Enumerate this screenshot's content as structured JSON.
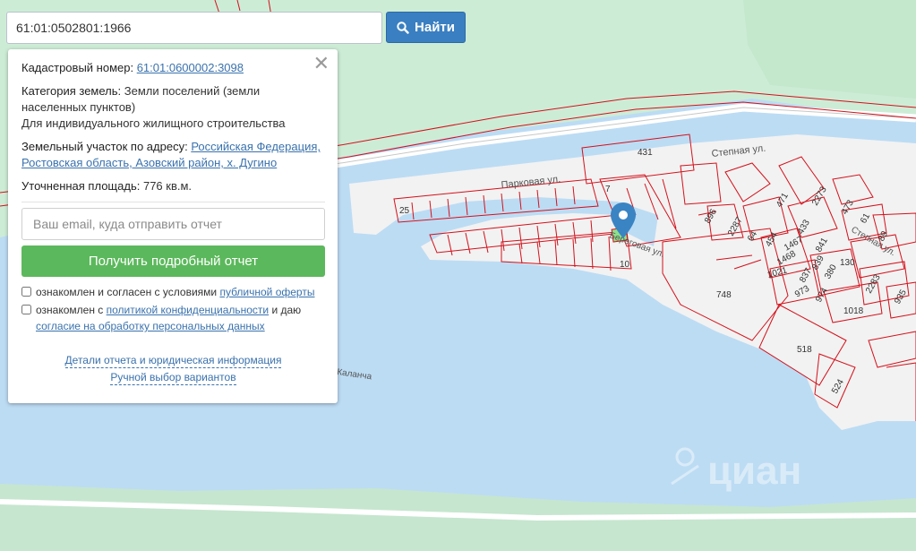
{
  "search": {
    "value": "61:01:0502801:1966",
    "button_label": "Найти",
    "button_icon": "search-icon"
  },
  "info": {
    "close_icon": "close-icon",
    "cadastral_label": "Кадастровый номер:",
    "cadastral_value": "61:01:0600002:3098",
    "category_label": "Категория земель:",
    "category_value": "Земли поселений (земли населенных пунктов)",
    "usage": "Для индивидуального жилищного строительства",
    "address_label": "Земельный участок по адресу:",
    "address_value": "Российская Федерация, Ростовская область, Азовский район, х. Дугино",
    "area_label": "Уточненная площадь:",
    "area_value": "776 кв.м.",
    "email_placeholder": "Ваш email, куда отправить отчет",
    "report_button": "Получить подробный отчет",
    "consent1_pre": "ознакомлен и согласен с условиями",
    "consent1_link": "публичной оферты",
    "consent2_pre": "ознакомлен с",
    "consent2_link": "политикой конфиденциальности",
    "consent2_mid": "и даю",
    "consent2_link2": "согласие на обработку персональных данных",
    "footer_link1": "Детали отчета и юридическая информация",
    "footer_link2": "Ручной выбор вариантов"
  },
  "map": {
    "colors": {
      "water": "#bcdcf4",
      "land": "#f2f2f2",
      "green": "#c8ead2",
      "parcel": "#d4101a",
      "selected": "#8ee08a",
      "marker": "#3a84c4"
    },
    "street_labels": [
      "Парковая ул.",
      "Степная ул.",
      "Береговая ул.",
      "Степная ул."
    ],
    "place_label": "Каланча",
    "parcel_numbers": [
      "431",
      "25",
      "7",
      "10",
      "896",
      "2287",
      "64",
      "454",
      "471",
      "2273",
      "473",
      "61",
      "89",
      "433",
      "1467",
      "841",
      "1468",
      "837",
      "839",
      "130",
      "380",
      "1021",
      "973",
      "974",
      "2283",
      "935",
      "1018",
      "748",
      "518",
      "524"
    ],
    "watermark": "циан",
    "marker_icon": "map-pin-icon"
  }
}
